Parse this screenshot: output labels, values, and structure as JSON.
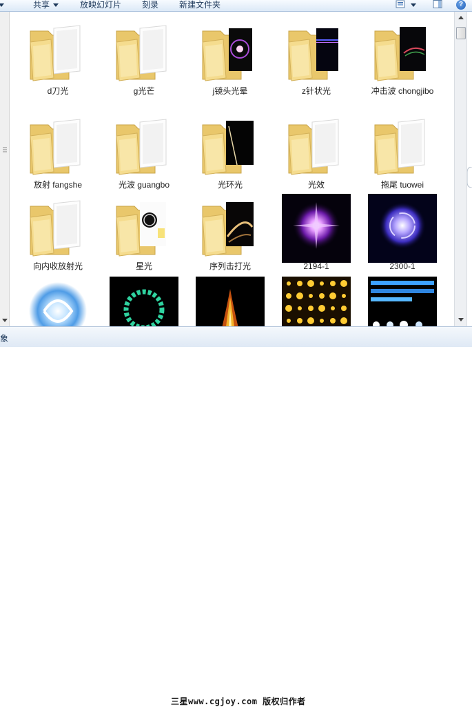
{
  "toolbar": {
    "share_label": "共享",
    "slideshow_label": "放映幻灯片",
    "burn_label": "刻录",
    "new_folder_label": "新建文件夹"
  },
  "items": [
    {
      "name": "d刀光",
      "kind": "folder",
      "preview": "blank"
    },
    {
      "name": "g光芒",
      "kind": "folder",
      "preview": "blank"
    },
    {
      "name": "j镜头光晕",
      "kind": "folder",
      "preview": "lens-flare"
    },
    {
      "name": "z针状光",
      "kind": "folder",
      "preview": "needle"
    },
    {
      "name": "冲击波 chongjibo",
      "kind": "folder",
      "preview": "shockwave"
    },
    {
      "name": "放射 fangshe",
      "kind": "folder",
      "preview": "blank"
    },
    {
      "name": "光波 guangbo",
      "kind": "folder",
      "preview": "blank"
    },
    {
      "name": "光环光",
      "kind": "folder",
      "preview": "ring-black"
    },
    {
      "name": "光效",
      "kind": "folder",
      "preview": "blank"
    },
    {
      "name": "拖尾 tuowei",
      "kind": "folder",
      "preview": "blank"
    },
    {
      "name": "向内收放射光",
      "kind": "folder",
      "preview": "blank"
    },
    {
      "name": "星光",
      "kind": "folder",
      "preview": "star"
    },
    {
      "name": "序列击打光",
      "kind": "folder",
      "preview": "strike"
    },
    {
      "name": "2194-1",
      "kind": "image",
      "preview": "purple-burst"
    },
    {
      "name": "2300-1",
      "kind": "image",
      "preview": "blue-swirl"
    },
    {
      "name": "",
      "kind": "image",
      "preview": "cyan-vortex"
    },
    {
      "name": "",
      "kind": "image",
      "preview": "green-ring"
    },
    {
      "name": "",
      "kind": "image",
      "preview": "fire-flame"
    },
    {
      "name": "",
      "kind": "image",
      "preview": "gold-sheet"
    },
    {
      "name": "",
      "kind": "image",
      "preview": "blue-sheet"
    }
  ],
  "status": {
    "text": "象"
  },
  "watermark": "三星www.cgjoy.com 版权归作者",
  "colors": {
    "folder": "#f3d98a",
    "accent": "#1e395b"
  }
}
